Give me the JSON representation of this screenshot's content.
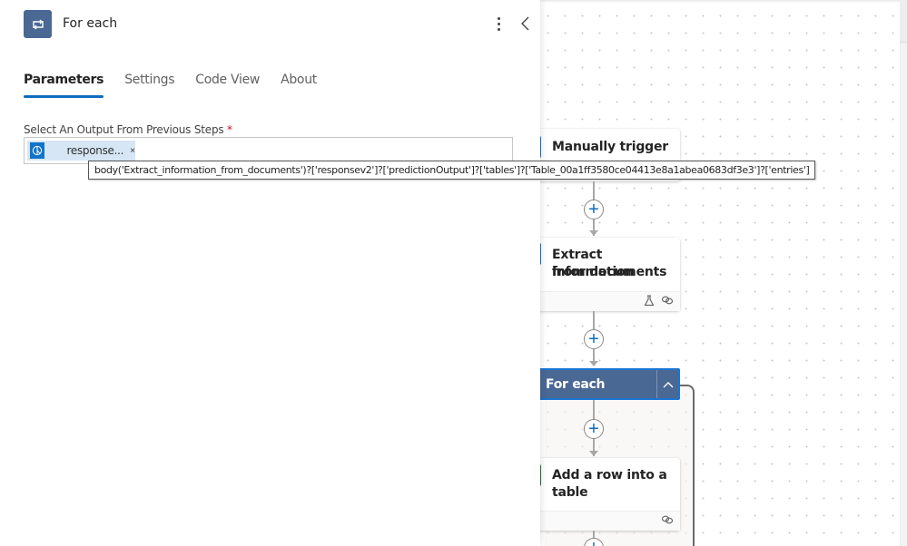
{
  "panel": {
    "title": "For each",
    "icon": "loop-icon",
    "tabs": [
      {
        "label": "Parameters",
        "active": true
      },
      {
        "label": "Settings",
        "active": false
      },
      {
        "label": "Code View",
        "active": false
      },
      {
        "label": "About",
        "active": false
      }
    ],
    "field": {
      "label": "Select An Output From Previous Steps",
      "required_marker": "*",
      "token": {
        "label": "response...",
        "remove": "×",
        "icon": "ai-builder-icon"
      },
      "tooltip": "body('Extract_information_from_documents')?['responsev2']?['predictionOutput']?['tables']?['Table_00a1ff3580ce04413e8a1abea0683df3e3']?['entries']"
    }
  },
  "flow": {
    "steps": [
      {
        "title": "Manually trigger a flow",
        "visible_title": "Manually trigger a",
        "icon_color": "#1274c8"
      },
      {
        "title_line1": "Extract information",
        "title_line2": "from documents",
        "icon_color": "#1274c8",
        "footer_icons": [
          "flask-icon",
          "link-icon"
        ]
      },
      {
        "title": "For each",
        "collapse_glyph": "^",
        "color": "#4a6894"
      },
      {
        "title_line1": "Add a row into a",
        "title_line2": "table",
        "icon_color": "#217346",
        "footer_icons": [
          "link-icon"
        ]
      }
    ],
    "add_glyph": "+"
  }
}
